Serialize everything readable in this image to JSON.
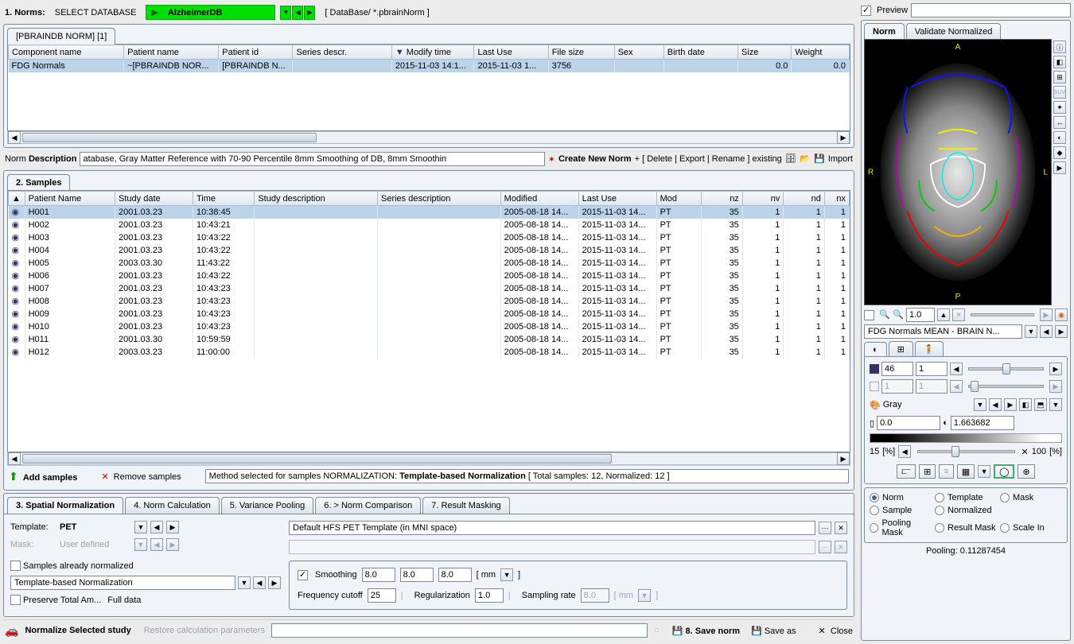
{
  "topbar": {
    "norms_label": "1. Norms:",
    "select_db_label": "SELECT DATABASE",
    "db_name": "AlzheimerDB",
    "db_path": "[ DataBase/ *.pbrainNorm ]",
    "preview_label": "Preview"
  },
  "norm_panel": {
    "tab_label": "[PBRAINDB NORM] [1]",
    "headers": [
      "Component name",
      "Patient name",
      "Patient id",
      "Series descr.",
      "Modify time",
      "Last Use",
      "File size",
      "Sex",
      "Birth date",
      "Size",
      "Weight"
    ],
    "row": {
      "component": "FDG Normals",
      "patient_name": "~[PBRAINDB NOR...",
      "patient_id": "[PBRAINDB N...",
      "modify": "2015-11-03 14:1...",
      "last_use": "2015-11-03 1...",
      "file_size": "3756",
      "size_v": "0.0",
      "weight_v": "0.0"
    }
  },
  "norm_desc": {
    "label_norm": "Norm ",
    "label_desc": "Description",
    "value": "atabase, Gray Matter Reference with 70-90 Percentile 8mm Smoothing of DB, 8mm Smoothin",
    "create_new": "Create New Norm",
    "existing_ops": "+ [ Delete | Export | Rename ] existing",
    "import": "Import"
  },
  "samples_panel": {
    "tab_label": "2. Samples",
    "headers": [
      "",
      "Patient Name",
      "Study date",
      "Time",
      "Study description",
      "Series description",
      "Modified",
      "Last Use",
      "Mod",
      "nz",
      "nv",
      "nd",
      "nx"
    ],
    "rows": [
      {
        "name": "H001",
        "date": "2001.03.23",
        "time": "10:38:45",
        "modified": "2005-08-18 14...",
        "lastuse": "2015-11-03 14...",
        "mod": "PT",
        "nz": "35",
        "nv": "1",
        "nd": "1",
        "nx": "1"
      },
      {
        "name": "H002",
        "date": "2001.03.23",
        "time": "10:43:21",
        "modified": "2005-08-18 14...",
        "lastuse": "2015-11-03 14...",
        "mod": "PT",
        "nz": "35",
        "nv": "1",
        "nd": "1",
        "nx": "1"
      },
      {
        "name": "H003",
        "date": "2001.03.23",
        "time": "10:43:22",
        "modified": "2005-08-18 14...",
        "lastuse": "2015-11-03 14...",
        "mod": "PT",
        "nz": "35",
        "nv": "1",
        "nd": "1",
        "nx": "1"
      },
      {
        "name": "H004",
        "date": "2001.03.23",
        "time": "10:43:22",
        "modified": "2005-08-18 14...",
        "lastuse": "2015-11-03 14...",
        "mod": "PT",
        "nz": "35",
        "nv": "1",
        "nd": "1",
        "nx": "1"
      },
      {
        "name": "H005",
        "date": "2003.03.30",
        "time": "11:43:22",
        "modified": "2005-08-18 14...",
        "lastuse": "2015-11-03 14...",
        "mod": "PT",
        "nz": "35",
        "nv": "1",
        "nd": "1",
        "nx": "1"
      },
      {
        "name": "H006",
        "date": "2001.03.23",
        "time": "10:43:22",
        "modified": "2005-08-18 14...",
        "lastuse": "2015-11-03 14...",
        "mod": "PT",
        "nz": "35",
        "nv": "1",
        "nd": "1",
        "nx": "1"
      },
      {
        "name": "H007",
        "date": "2001.03.23",
        "time": "10:43:23",
        "modified": "2005-08-18 14...",
        "lastuse": "2015-11-03 14...",
        "mod": "PT",
        "nz": "35",
        "nv": "1",
        "nd": "1",
        "nx": "1"
      },
      {
        "name": "H008",
        "date": "2001.03.23",
        "time": "10:43:23",
        "modified": "2005-08-18 14...",
        "lastuse": "2015-11-03 14...",
        "mod": "PT",
        "nz": "35",
        "nv": "1",
        "nd": "1",
        "nx": "1"
      },
      {
        "name": "H009",
        "date": "2001.03.23",
        "time": "10:43:23",
        "modified": "2005-08-18 14...",
        "lastuse": "2015-11-03 14...",
        "mod": "PT",
        "nz": "35",
        "nv": "1",
        "nd": "1",
        "nx": "1"
      },
      {
        "name": "H010",
        "date": "2001.03.23",
        "time": "10:43:23",
        "modified": "2005-08-18 14...",
        "lastuse": "2015-11-03 14...",
        "mod": "PT",
        "nz": "35",
        "nv": "1",
        "nd": "1",
        "nx": "1"
      },
      {
        "name": "H011",
        "date": "2001.03.30",
        "time": "10:59:59",
        "modified": "2005-08-18 14...",
        "lastuse": "2015-11-03 14...",
        "mod": "PT",
        "nz": "35",
        "nv": "1",
        "nd": "1",
        "nx": "1"
      },
      {
        "name": "H012",
        "date": "2003.03.23",
        "time": "11:00:00",
        "modified": "2005-08-18 14...",
        "lastuse": "2015-11-03 14...",
        "mod": "PT",
        "nz": "35",
        "nv": "1",
        "nd": "1",
        "nx": "1"
      }
    ],
    "add_samples": "Add samples",
    "remove_samples": "Remove samples",
    "method_label": "Method selected for samples NORMALIZATION: ",
    "method_value": "Template-based Normalization",
    "method_totals": " [ Total samples: 12, Normalized: 12 ]"
  },
  "lower_tabs": {
    "t3": "3. Spatial Normalization",
    "t4": "4. Norm Calculation",
    "t5": "5. Variance Pooling",
    "t6": "6. > Norm Comparison",
    "t7": "7. Result Masking"
  },
  "spatial_norm": {
    "template_label": "Template:",
    "template_value": "PET",
    "template_full": "Default HFS PET Template (in MNI space)",
    "mask_label": "Mask:",
    "mask_value": "User defined",
    "samples_already": "Samples already normalized",
    "method_dropdown": "Template-based Normalization",
    "preserve_total": "Preserve Total Am...",
    "full_data": "Full data",
    "smoothing_label": "Smoothing",
    "smoothing_v1": "8.0",
    "smoothing_v2": "8.0",
    "smoothing_v3": "8.0",
    "smoothing_unit": "[   mm",
    "freq_cutoff_label": "Frequency cutoff",
    "freq_cutoff_value": "25",
    "regularization_label": "Regularization",
    "regularization_value": "1.0",
    "sampling_label": "Sampling rate",
    "sampling_value": "8.0",
    "sampling_unit": "[   mm"
  },
  "bottom_bar": {
    "normalize": "Normalize Selected study",
    "restore": "Restore calculation parameters",
    "save_norm": "8. Save norm",
    "save_as": "Save as",
    "close": "Close"
  },
  "right_tabs": {
    "norm": "Norm",
    "validate": "Validate Normalized"
  },
  "viewer": {
    "zoom": "1.0",
    "title": "FDG Normals MEAN - BRAIN N...",
    "v1": "46",
    "v2": "1",
    "v3": "1",
    "v4": "1",
    "colormap": "Gray",
    "min": "0.0",
    "max": "1.663682",
    "pct_low": "15",
    "pct_high": "100",
    "pct_unit_l": "[%]",
    "pct_unit_r": "[%]"
  },
  "source_radios": {
    "norm": "Norm",
    "template": "Template",
    "mask": "Mask",
    "sample": "Sample",
    "normalized": "Normalized",
    "pooling_mask": "Pooling Mask",
    "result_mask": "Result Mask",
    "scale_in": "Scale In"
  },
  "pooling_status": "Pooling: 0.11287454"
}
